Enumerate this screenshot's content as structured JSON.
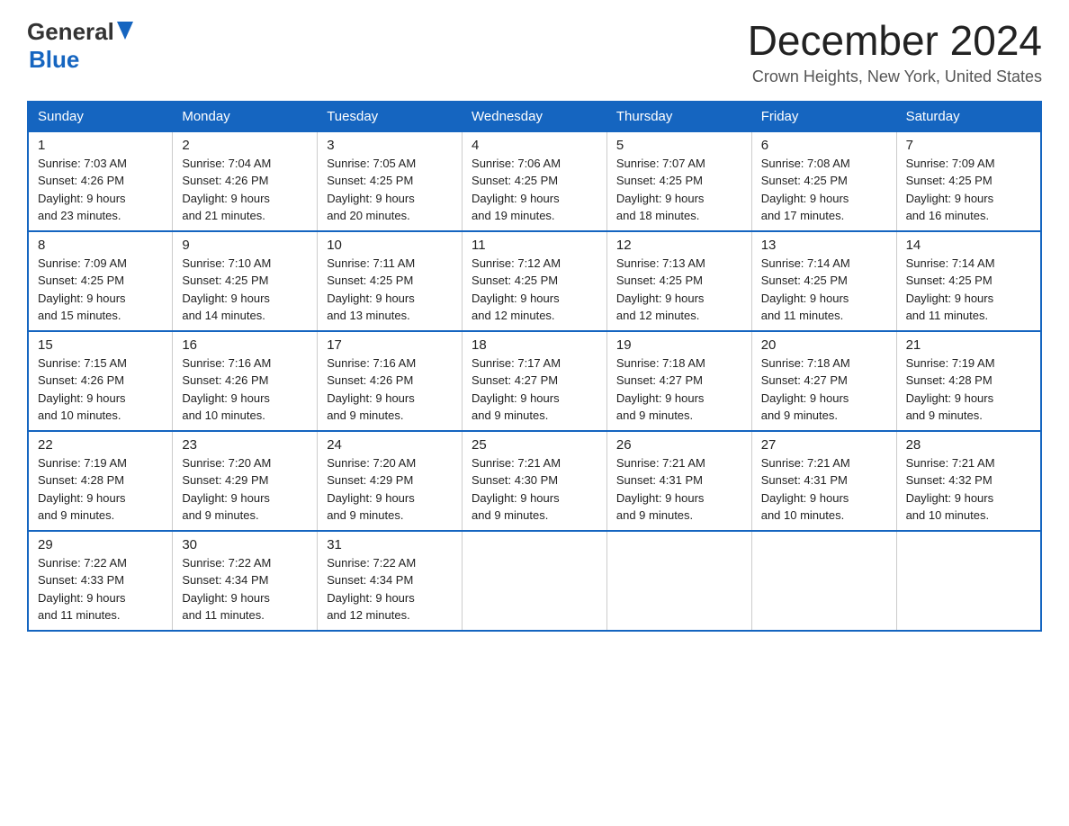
{
  "header": {
    "logo_line1": "General",
    "logo_line2": "Blue",
    "month_year": "December 2024",
    "location": "Crown Heights, New York, United States"
  },
  "days_of_week": [
    "Sunday",
    "Monday",
    "Tuesday",
    "Wednesday",
    "Thursday",
    "Friday",
    "Saturday"
  ],
  "weeks": [
    [
      {
        "day": "1",
        "sunrise": "7:03 AM",
        "sunset": "4:26 PM",
        "daylight": "9 hours and 23 minutes."
      },
      {
        "day": "2",
        "sunrise": "7:04 AM",
        "sunset": "4:26 PM",
        "daylight": "9 hours and 21 minutes."
      },
      {
        "day": "3",
        "sunrise": "7:05 AM",
        "sunset": "4:25 PM",
        "daylight": "9 hours and 20 minutes."
      },
      {
        "day": "4",
        "sunrise": "7:06 AM",
        "sunset": "4:25 PM",
        "daylight": "9 hours and 19 minutes."
      },
      {
        "day": "5",
        "sunrise": "7:07 AM",
        "sunset": "4:25 PM",
        "daylight": "9 hours and 18 minutes."
      },
      {
        "day": "6",
        "sunrise": "7:08 AM",
        "sunset": "4:25 PM",
        "daylight": "9 hours and 17 minutes."
      },
      {
        "day": "7",
        "sunrise": "7:09 AM",
        "sunset": "4:25 PM",
        "daylight": "9 hours and 16 minutes."
      }
    ],
    [
      {
        "day": "8",
        "sunrise": "7:09 AM",
        "sunset": "4:25 PM",
        "daylight": "9 hours and 15 minutes."
      },
      {
        "day": "9",
        "sunrise": "7:10 AM",
        "sunset": "4:25 PM",
        "daylight": "9 hours and 14 minutes."
      },
      {
        "day": "10",
        "sunrise": "7:11 AM",
        "sunset": "4:25 PM",
        "daylight": "9 hours and 13 minutes."
      },
      {
        "day": "11",
        "sunrise": "7:12 AM",
        "sunset": "4:25 PM",
        "daylight": "9 hours and 12 minutes."
      },
      {
        "day": "12",
        "sunrise": "7:13 AM",
        "sunset": "4:25 PM",
        "daylight": "9 hours and 12 minutes."
      },
      {
        "day": "13",
        "sunrise": "7:14 AM",
        "sunset": "4:25 PM",
        "daylight": "9 hours and 11 minutes."
      },
      {
        "day": "14",
        "sunrise": "7:14 AM",
        "sunset": "4:25 PM",
        "daylight": "9 hours and 11 minutes."
      }
    ],
    [
      {
        "day": "15",
        "sunrise": "7:15 AM",
        "sunset": "4:26 PM",
        "daylight": "9 hours and 10 minutes."
      },
      {
        "day": "16",
        "sunrise": "7:16 AM",
        "sunset": "4:26 PM",
        "daylight": "9 hours and 10 minutes."
      },
      {
        "day": "17",
        "sunrise": "7:16 AM",
        "sunset": "4:26 PM",
        "daylight": "9 hours and 9 minutes."
      },
      {
        "day": "18",
        "sunrise": "7:17 AM",
        "sunset": "4:27 PM",
        "daylight": "9 hours and 9 minutes."
      },
      {
        "day": "19",
        "sunrise": "7:18 AM",
        "sunset": "4:27 PM",
        "daylight": "9 hours and 9 minutes."
      },
      {
        "day": "20",
        "sunrise": "7:18 AM",
        "sunset": "4:27 PM",
        "daylight": "9 hours and 9 minutes."
      },
      {
        "day": "21",
        "sunrise": "7:19 AM",
        "sunset": "4:28 PM",
        "daylight": "9 hours and 9 minutes."
      }
    ],
    [
      {
        "day": "22",
        "sunrise": "7:19 AM",
        "sunset": "4:28 PM",
        "daylight": "9 hours and 9 minutes."
      },
      {
        "day": "23",
        "sunrise": "7:20 AM",
        "sunset": "4:29 PM",
        "daylight": "9 hours and 9 minutes."
      },
      {
        "day": "24",
        "sunrise": "7:20 AM",
        "sunset": "4:29 PM",
        "daylight": "9 hours and 9 minutes."
      },
      {
        "day": "25",
        "sunrise": "7:21 AM",
        "sunset": "4:30 PM",
        "daylight": "9 hours and 9 minutes."
      },
      {
        "day": "26",
        "sunrise": "7:21 AM",
        "sunset": "4:31 PM",
        "daylight": "9 hours and 9 minutes."
      },
      {
        "day": "27",
        "sunrise": "7:21 AM",
        "sunset": "4:31 PM",
        "daylight": "9 hours and 10 minutes."
      },
      {
        "day": "28",
        "sunrise": "7:21 AM",
        "sunset": "4:32 PM",
        "daylight": "9 hours and 10 minutes."
      }
    ],
    [
      {
        "day": "29",
        "sunrise": "7:22 AM",
        "sunset": "4:33 PM",
        "daylight": "9 hours and 11 minutes."
      },
      {
        "day": "30",
        "sunrise": "7:22 AM",
        "sunset": "4:34 PM",
        "daylight": "9 hours and 11 minutes."
      },
      {
        "day": "31",
        "sunrise": "7:22 AM",
        "sunset": "4:34 PM",
        "daylight": "9 hours and 12 minutes."
      },
      null,
      null,
      null,
      null
    ]
  ],
  "labels": {
    "sunrise": "Sunrise:",
    "sunset": "Sunset:",
    "daylight": "Daylight:"
  }
}
